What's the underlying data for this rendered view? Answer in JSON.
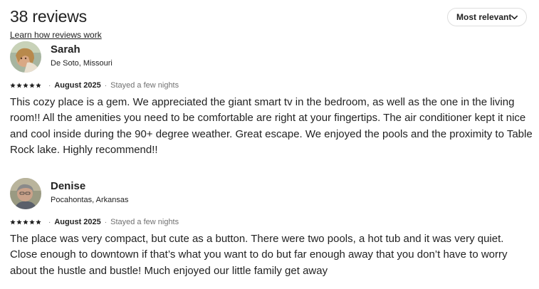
{
  "header": {
    "title": "38 reviews",
    "learn_link": "Learn how reviews work",
    "sort_label": "Most relevant"
  },
  "colors": {
    "text": "#222222",
    "muted": "#717171",
    "border": "#dddddd"
  },
  "reviews": [
    {
      "name": "Sarah",
      "location": "De Soto, Missouri",
      "rating": 5,
      "date": "August 2025",
      "stay": "Stayed a few nights",
      "text": "This cozy place is a gem. We appreciated the giant smart tv in the bedroom, as well as the one in the living room!!  All the amenities you need to be comfortable are right at your fingertips.  The air conditioner kept it nice and cool inside during the 90+ degree weather.   Great escape.  We enjoyed the pools and the proximity to Table Rock lake. Highly recommend!!"
    },
    {
      "name": "Denise",
      "location": "Pocahontas, Arkansas",
      "rating": 5,
      "date": "August 2025",
      "stay": "Stayed a few nights",
      "text": "The place was very compact, but cute as a button. There were two pools, a hot tub and it was very quiet. Close enough to downtown if that’s what you want to do but far enough away that you don’t have to worry about the hustle and bustle! Much enjoyed our little family get away"
    }
  ]
}
